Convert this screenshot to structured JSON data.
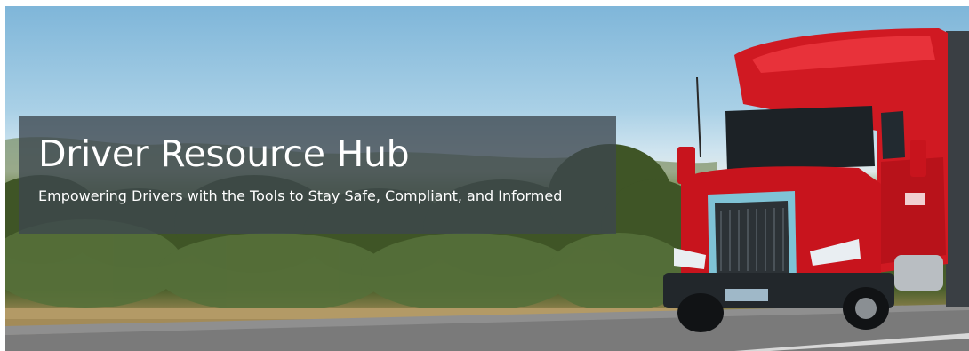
{
  "hero": {
    "title": "Driver Resource Hub",
    "subtitle": "Empowering Drivers with the Tools to Stay Safe, Compliant, and Informed",
    "image_subject": "red-semi-truck-on-highway",
    "colors": {
      "overlay": "#3c464e",
      "text": "#ffffff",
      "truck": "#d4121c",
      "sky": "#a9d0e6",
      "foliage": "#4a5f2b"
    }
  }
}
